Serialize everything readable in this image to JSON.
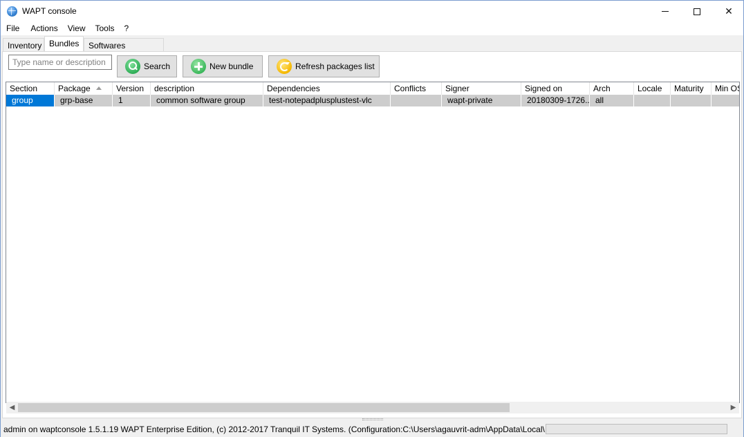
{
  "window": {
    "title": "WAPT console",
    "controls": {
      "minimize": "",
      "maximize": "",
      "close": "✕"
    }
  },
  "menu": [
    "File",
    "Actions",
    "View",
    "Tools",
    "?"
  ],
  "tabs": [
    {
      "label": "Inventory",
      "active": false
    },
    {
      "label": "Bundles",
      "active": true
    },
    {
      "label": "Softwares repository",
      "active": false
    }
  ],
  "toolbar": {
    "search_placeholder": "Type name or description",
    "search_value": "",
    "search_label": "Search",
    "new_bundle_label": "New bundle",
    "refresh_label": "Refresh packages list"
  },
  "grid": {
    "columns": [
      "Section",
      "Package",
      "Version",
      "description",
      "Dependencies",
      "Conflicts",
      "Signer",
      "Signed on",
      "Arch",
      "Locale",
      "Maturity",
      "Min OS"
    ],
    "sorted_column": "Package",
    "rows": [
      [
        "group",
        "grp-base",
        "1",
        "common software group",
        "test-notepadplusplustest-vlc",
        "",
        "wapt-private",
        "20180309-1726...",
        "all",
        "",
        "",
        ""
      ]
    ]
  },
  "statusbar": {
    "text": "admin on waptconsole 1.5.1.19 WAPT Enterprise Edition, (c) 2012-2017 Tranquil IT Systems. (Configuration:C:\\Users\\agauvrit-adm\\AppData\\Local\\waptconsole\\waptconsole.ini)"
  },
  "colors": {
    "selection": "#0078d7",
    "row_bg": "#cdcdcd",
    "button_bg": "#e1e1e1"
  }
}
